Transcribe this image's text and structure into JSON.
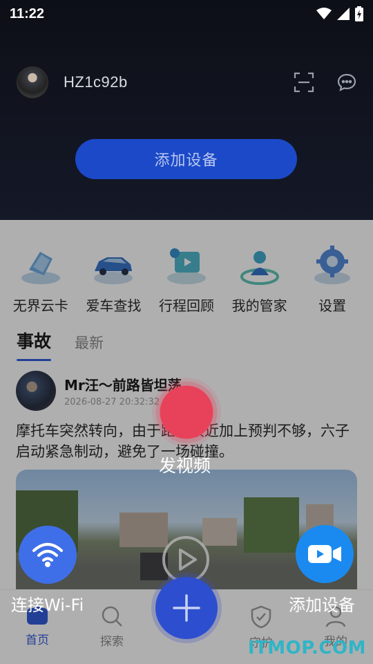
{
  "status_bar": {
    "time": "11:22"
  },
  "header": {
    "username": "HZ1c92b",
    "add_device_label": "添加设备"
  },
  "quick_actions": [
    {
      "label": "无界云卡",
      "icon": "cloud-card-icon"
    },
    {
      "label": "爱车查找",
      "icon": "car-search-icon"
    },
    {
      "label": "行程回顾",
      "icon": "trip-review-icon"
    },
    {
      "label": "我的管家",
      "icon": "butler-icon"
    },
    {
      "label": "设置",
      "icon": "settings-icon"
    }
  ],
  "tabs": [
    {
      "label": "事故",
      "active": true
    },
    {
      "label": "最新",
      "active": false
    }
  ],
  "post": {
    "author": "Mr汪～前路皆坦荡",
    "time": "2026-08-27 20:32:32",
    "text": "摩托车突然转向，由于距离较近加上预判不够，六子启动紧急制动，避免了一场碰撞。"
  },
  "overlay": {
    "record_label": "发视频",
    "wifi_label": "连接Wi-Fi",
    "camera_label": "添加设备"
  },
  "bottom_nav": [
    {
      "label": "首页",
      "active": true
    },
    {
      "label": "探索",
      "active": false
    },
    {
      "label": "守护",
      "active": false
    },
    {
      "label": "我的",
      "active": false
    }
  ],
  "watermark": "ITMOP.COM",
  "colors": {
    "accent": "#2a55d8",
    "record": "#e8425a",
    "wifi": "#3f6fe8",
    "camera": "#1a8af0"
  }
}
